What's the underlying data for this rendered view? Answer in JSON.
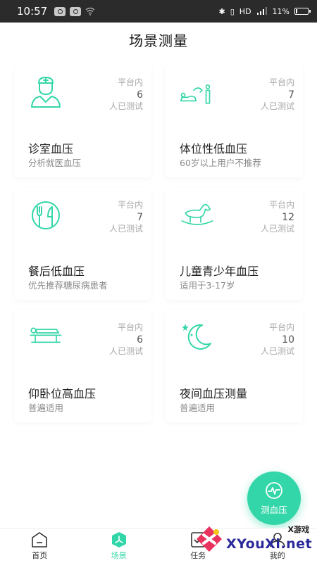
{
  "status_bar": {
    "time": "10:57",
    "network": "HD",
    "battery": "11%"
  },
  "page": {
    "title": "场景测量"
  },
  "accent": "#33d6a8",
  "cards": [
    {
      "icon": "doctor-icon",
      "stat_label": "平台内",
      "count": "6",
      "stat_suffix": "人已测试",
      "title": "诊室血压",
      "subtitle": "分析就医血压"
    },
    {
      "icon": "posture-icon",
      "stat_label": "平台内",
      "count": "7",
      "stat_suffix": "人已测试",
      "title": "体位性低血压",
      "subtitle": "60岁以上用户不推荐"
    },
    {
      "icon": "dining-icon",
      "stat_label": "平台内",
      "count": "7",
      "stat_suffix": "人已测试",
      "title": "餐后低血压",
      "subtitle": "优先推荐糖尿病患者"
    },
    {
      "icon": "rocking-horse-icon",
      "stat_label": "平台内",
      "count": "12",
      "stat_suffix": "人已测试",
      "title": "儿童青少年血压",
      "subtitle": "适用于3-17岁"
    },
    {
      "icon": "lying-bed-icon",
      "stat_label": "平台内",
      "count": "6",
      "stat_suffix": "人已测试",
      "title": "仰卧位高血压",
      "subtitle": "普遍适用"
    },
    {
      "icon": "moon-stars-icon",
      "stat_label": "平台内",
      "count": "10",
      "stat_suffix": "人已测试",
      "title": "夜间血压测量",
      "subtitle": "普遍适用"
    }
  ],
  "fab": {
    "label": "测血压",
    "icon": "waveform-icon"
  },
  "nav": {
    "items": [
      {
        "label": "首页",
        "icon": "home-icon"
      },
      {
        "label": "场景",
        "icon": "scene-icon",
        "active": true
      },
      {
        "label": "任务",
        "icon": "task-icon"
      },
      {
        "label": "我的",
        "icon": "profile-icon"
      }
    ]
  },
  "watermark": {
    "small": "X游戏",
    "text": "XYouXi.net"
  }
}
